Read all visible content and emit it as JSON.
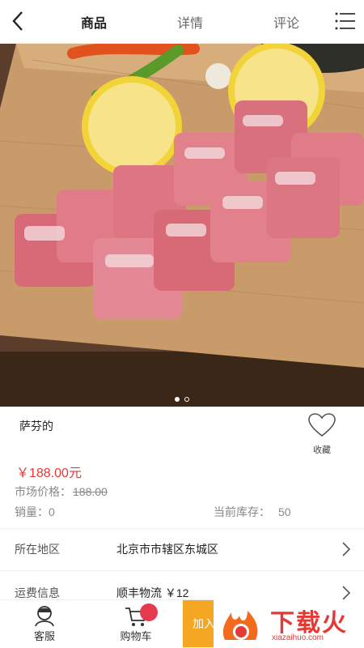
{
  "nav": {
    "tabs": [
      {
        "label": "商品",
        "active": true
      },
      {
        "label": "详情",
        "active": false
      },
      {
        "label": "评论",
        "active": false
      }
    ]
  },
  "gallery": {
    "page_count": 2,
    "current_index": 0
  },
  "product": {
    "name": "萨芬的",
    "favorite_label": "收藏",
    "price": "￥188.00元",
    "market_price_label": "市场价格：",
    "market_price": "188.00",
    "sales_label": "销量：",
    "sales_value": "0",
    "stock_label": "当前库存：",
    "stock_value": "50"
  },
  "info_rows": [
    {
      "key": "所在地区",
      "value": "北京市市辖区东城区"
    },
    {
      "key": "运费信息",
      "value": "顺丰物流 ￥12"
    }
  ],
  "bottom_bar": {
    "service_label": "客服",
    "cart_label": "购物车",
    "add_cart_label": "加入"
  },
  "watermark": {
    "brand": "下载火",
    "site": "xiazaihuo.com"
  },
  "colors": {
    "price": "#e53935",
    "add_cart_bg": "#f5a623",
    "badge": "#e53950"
  }
}
